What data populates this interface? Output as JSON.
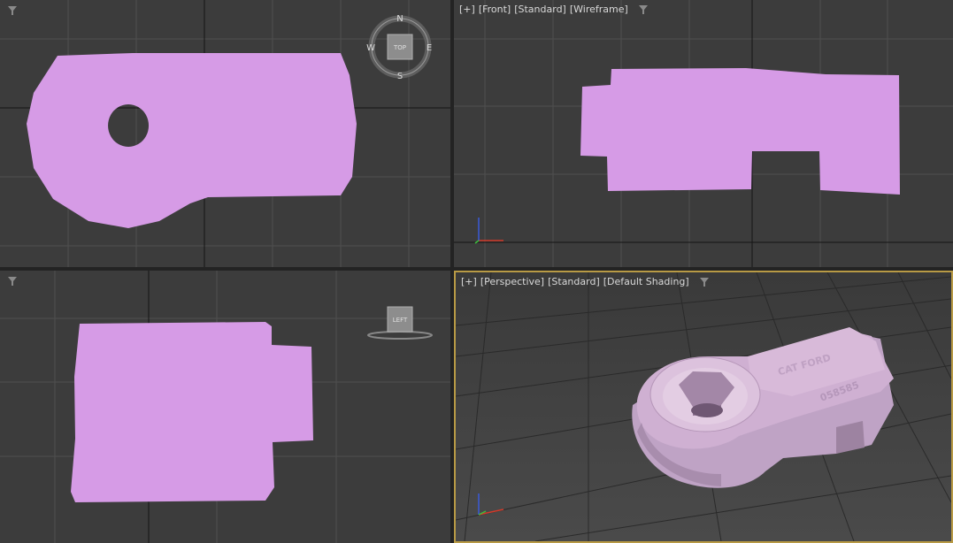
{
  "viewports": {
    "top": {
      "compass": {
        "n": "N",
        "s": "S",
        "e": "E",
        "w": "W",
        "cube": "TOP"
      }
    },
    "front": {
      "label": {
        "plus": "[+]",
        "view": "[Front]",
        "mode": "[Standard]",
        "shading": "[Wireframe]"
      }
    },
    "left": {
      "cube": "LEFT"
    },
    "perspective": {
      "label": {
        "plus": "[+]",
        "view": "[Perspective]",
        "mode": "[Standard]",
        "shading": "[Default Shading]"
      },
      "engraving": {
        "top": "CAT FORD",
        "side": "058585"
      }
    }
  },
  "colors": {
    "viewport_bg": "#3c3c3c",
    "grid": "#4f4f4f",
    "grid_axis": "#151515",
    "mesh": "#d69be6",
    "mesh_shaded": "#cfb0d2",
    "active_border": "#b89a45",
    "axis_x": "#d23a2a",
    "axis_y": "#3cbf3c",
    "axis_z": "#3a5ad8"
  },
  "icons": {
    "filter": "filter-icon",
    "compass": "viewcube-compass-icon",
    "axis": "axis-tripod-icon"
  }
}
